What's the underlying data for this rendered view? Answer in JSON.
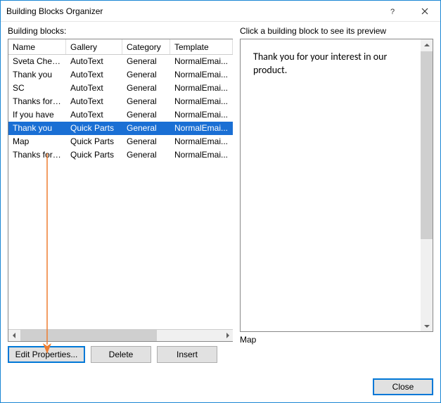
{
  "titlebar": {
    "title": "Building Blocks Organizer"
  },
  "left": {
    "label": "Building blocks:",
    "headers": {
      "name": "Name",
      "gallery": "Gallery",
      "category": "Category",
      "template": "Template"
    },
    "rows": [
      {
        "name": "Sveta Cheu...",
        "gallery": "AutoText",
        "category": "General",
        "template": "NormalEmai...",
        "selected": false
      },
      {
        "name": "Thank you",
        "gallery": "AutoText",
        "category": "General",
        "template": "NormalEmai...",
        "selected": false
      },
      {
        "name": "SC",
        "gallery": "AutoText",
        "category": "General",
        "template": "NormalEmai...",
        "selected": false
      },
      {
        "name": "Thanks for ...",
        "gallery": "AutoText",
        "category": "General",
        "template": "NormalEmai...",
        "selected": false
      },
      {
        "name": "If you have",
        "gallery": "AutoText",
        "category": "General",
        "template": "NormalEmai...",
        "selected": false
      },
      {
        "name": "Thank you",
        "gallery": "Quick Parts",
        "category": "General",
        "template": "NormalEmai...",
        "selected": true
      },
      {
        "name": "Map",
        "gallery": "Quick Parts",
        "category": "General",
        "template": "NormalEmai...",
        "selected": false
      },
      {
        "name": "Thanks for ...",
        "gallery": "Quick Parts",
        "category": "General",
        "template": "NormalEmai...",
        "selected": false
      }
    ]
  },
  "right": {
    "label": "Click a building block to see its preview",
    "preview_text": "Thank you for your interest in our product.",
    "selected_name": "Map"
  },
  "buttons": {
    "edit": "Edit Properties...",
    "delete": "Delete",
    "insert": "Insert",
    "close": "Close"
  }
}
